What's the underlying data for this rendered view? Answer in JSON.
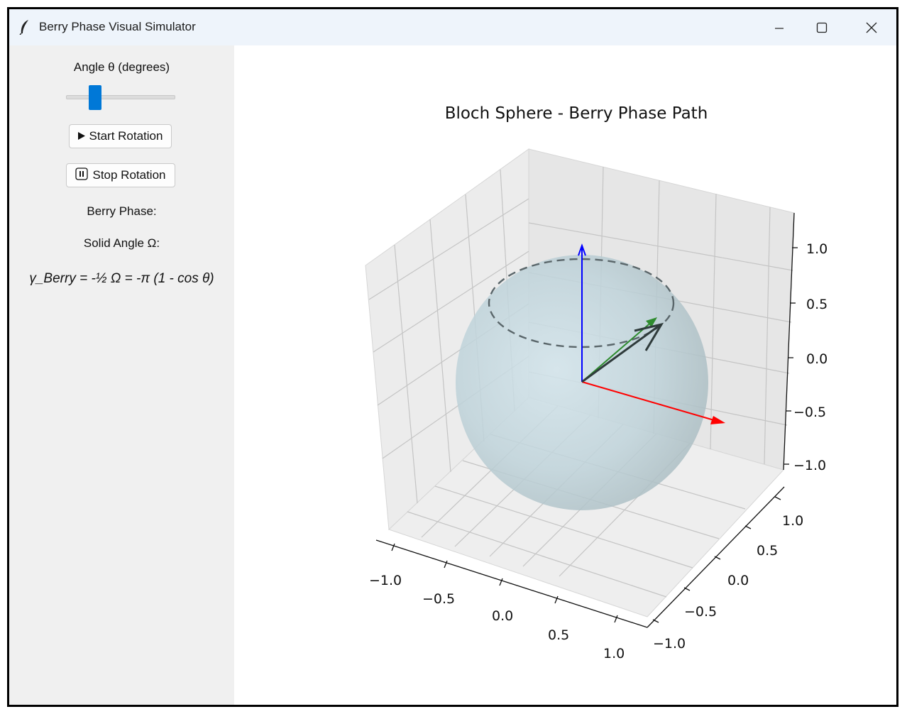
{
  "window": {
    "title": "Berry Phase Visual Simulator",
    "controls": [
      "minimize",
      "maximize",
      "close"
    ]
  },
  "sidebar": {
    "angle_label": "Angle θ (degrees)",
    "angle_slider_fraction": 0.26,
    "start_button": "Start Rotation",
    "start_icon": "play-icon",
    "stop_button": "Stop Rotation",
    "stop_icon": "pause-icon",
    "berry_phase_label": "Berry Phase:",
    "solid_angle_label": "Solid Angle Ω:",
    "formula": "γ_Berry = -½ Ω = -π (1 - cos θ)"
  },
  "chart_data": {
    "type": "3d-vector",
    "title": "Bloch Sphere - Berry Phase Path",
    "z_ticks": [
      "1.0",
      "0.5",
      "0.0",
      "−0.5",
      "−1.0"
    ],
    "x_ticks": [
      "−1.0",
      "−0.5",
      "0.0",
      "0.5",
      "1.0"
    ],
    "y_ticks": [
      "1.0",
      "0.5",
      "0.0",
      "−0.5",
      "−1.0"
    ],
    "xlim": [
      -1.0,
      1.0
    ],
    "ylim": [
      -1.0,
      1.0
    ],
    "zlim": [
      -1.0,
      1.0
    ],
    "grid": true,
    "colors": {
      "x_axis": "#ff0000",
      "y_axis": "#008000",
      "z_axis": "#0000ff",
      "state_vector": "#2f3f3f",
      "sphere": "#add8e6",
      "path": "#555555"
    }
  }
}
